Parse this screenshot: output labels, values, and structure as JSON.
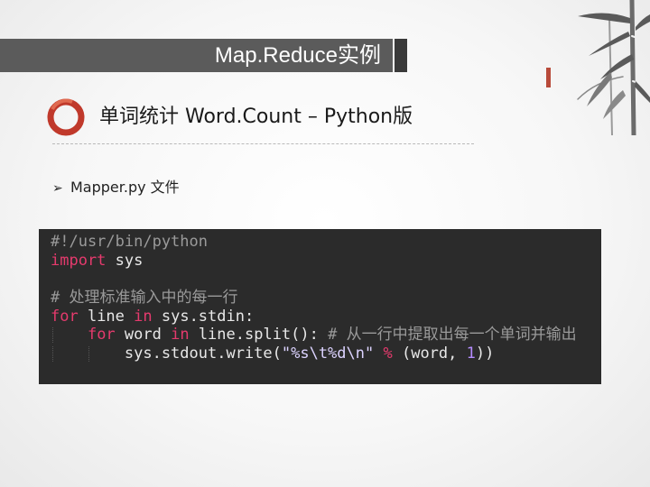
{
  "slide": {
    "title": "Map.Reduce实例",
    "heading": "单词统计 Word.Count – Python版",
    "bullet_text": "Mapper.py 文件"
  },
  "code": {
    "lines": [
      [
        {
          "t": "#!/usr/bin/python",
          "c": "comment"
        }
      ],
      [
        {
          "t": "import",
          "c": "kw"
        },
        {
          "t": " sys",
          "c": "plain"
        }
      ],
      [],
      [
        {
          "t": "# 处理标准输入中的每一行",
          "c": "comment"
        }
      ],
      [
        {
          "t": "for",
          "c": "kw"
        },
        {
          "t": " line ",
          "c": "plain"
        },
        {
          "t": "in",
          "c": "kw"
        },
        {
          "t": " sys.stdin:",
          "c": "plain"
        }
      ],
      [
        {
          "t": "    ",
          "c": "plain"
        },
        {
          "t": "for",
          "c": "kw"
        },
        {
          "t": " word ",
          "c": "plain"
        },
        {
          "t": "in",
          "c": "kw"
        },
        {
          "t": " line.split(): ",
          "c": "plain"
        },
        {
          "t": "# 从一行中提取出每一个单词并输出",
          "c": "comment"
        }
      ],
      [
        {
          "t": "        sys.stdout.write(",
          "c": "plain"
        },
        {
          "t": "\"%s\\t%d\\n\"",
          "c": "str"
        },
        {
          "t": " ",
          "c": "plain"
        },
        {
          "t": "%",
          "c": "op"
        },
        {
          "t": " (word, ",
          "c": "plain"
        },
        {
          "t": "1",
          "c": "num"
        },
        {
          "t": "))",
          "c": "plain"
        }
      ]
    ]
  },
  "colors": {
    "title_bar": "#5b5b5b",
    "logo_red": "#c0392b",
    "code_bg": "#2b2b2b",
    "comment": "#9a9a9a",
    "kw": "#e53a6d",
    "plain": "#e8e8e8",
    "str": "#dcd3ff",
    "op": "#e53a6d",
    "num": "#b58cff"
  },
  "icons": {
    "logo": "red-ring-logo",
    "bullet": "arrow-bullet-icon",
    "decoration": "bamboo-ink-painting"
  }
}
